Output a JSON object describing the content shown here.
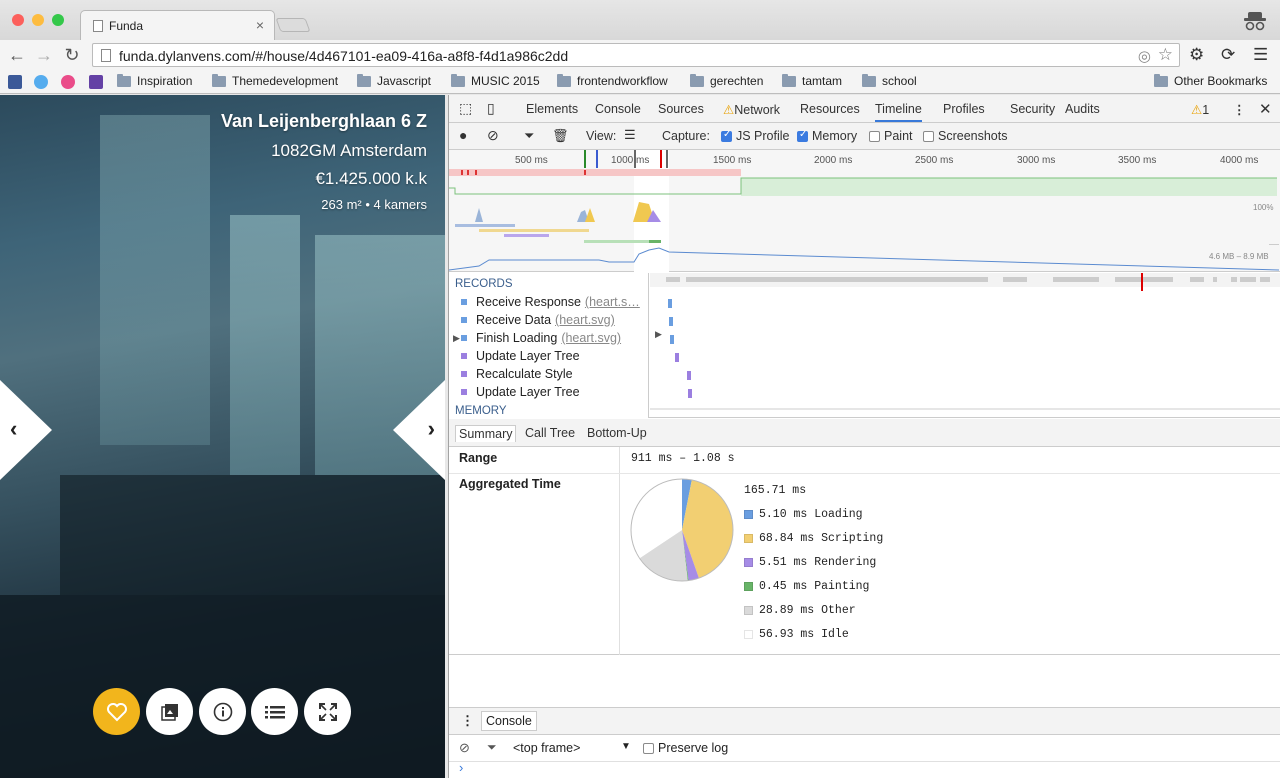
{
  "browser": {
    "tab_title": "Funda",
    "url": "funda.dylanvens.com/#/house/4d467101-ea09-416a-a8f8-f4d1a986c2dd",
    "bookmarks": [
      "Inspiration",
      "Themedevelopment",
      "Javascript",
      "MUSIC 2015",
      "frontendworkflow",
      "gerechten",
      "tamtam",
      "school"
    ],
    "other_bookmarks": "Other Bookmarks"
  },
  "listing": {
    "street": "Van Leijenberghlaan 6 Z",
    "city": "1082GM Amsterdam",
    "price": "€1.425.000 k.k",
    "meta": "263 m² • 4 kamers",
    "accent_color": "#f2b51c"
  },
  "devtools": {
    "tabs": [
      "Elements",
      "Console",
      "Sources",
      "Network",
      "Resources",
      "Timeline",
      "Profiles",
      "Security",
      "Audits"
    ],
    "active_tab": "Timeline",
    "warning_count": "1",
    "toolbar": {
      "view_label": "View:",
      "capture_label": "Capture:",
      "js_profile": "JS Profile",
      "memory": "Memory",
      "paint": "Paint",
      "screenshots": "Screenshots"
    },
    "ruler": [
      "500 ms",
      "1000 ms",
      "1500 ms",
      "2000 ms",
      "2500 ms",
      "3000 ms",
      "3500 ms",
      "4000 ms"
    ],
    "overview_pct": "100%",
    "overview_mem": "4.6 MB – 8.9 MB",
    "records_header": "RECORDS",
    "memory_header": "MEMORY",
    "records": [
      {
        "label": "Receive Response",
        "sub": "(heart.s…",
        "color": "#6a9ee0",
        "expand": false
      },
      {
        "label": "Receive Data",
        "sub": "(heart.svg)",
        "color": "#6a9ee0",
        "expand": false
      },
      {
        "label": "Finish Loading",
        "sub": "(heart.svg)",
        "color": "#6a9ee0",
        "expand": true
      },
      {
        "label": "Update Layer Tree",
        "sub": "",
        "color": "#9b7fe0",
        "expand": false
      },
      {
        "label": "Recalculate Style",
        "sub": "",
        "color": "#9b7fe0",
        "expand": false
      },
      {
        "label": "Update Layer Tree",
        "sub": "",
        "color": "#9b7fe0",
        "expand": false
      }
    ],
    "summary_tabs": [
      "Summary",
      "Call Tree",
      "Bottom-Up"
    ],
    "summary": {
      "range_label": "Range",
      "range_value": "911 ms – 1.08 s",
      "aggregated_label": "Aggregated Time",
      "total": "165.71 ms",
      "items": [
        {
          "text": "5.10 ms Loading",
          "color": "#6a9ee0",
          "value": 5.1
        },
        {
          "text": "68.84 ms Scripting",
          "color": "#f2cf72",
          "value": 68.84
        },
        {
          "text": "5.51 ms Rendering",
          "color": "#a68ce6",
          "value": 5.51
        },
        {
          "text": "0.45 ms Painting",
          "color": "#68b468",
          "value": 0.45
        },
        {
          "text": "28.89 ms Other",
          "color": "#dadada",
          "value": 28.89
        },
        {
          "text": "56.93 ms Idle",
          "color": "#ffffff",
          "value": 56.93
        }
      ]
    },
    "console": {
      "tab": "Console",
      "frame": "<top frame>",
      "preserve_log": "Preserve log",
      "prompt": "›"
    }
  }
}
